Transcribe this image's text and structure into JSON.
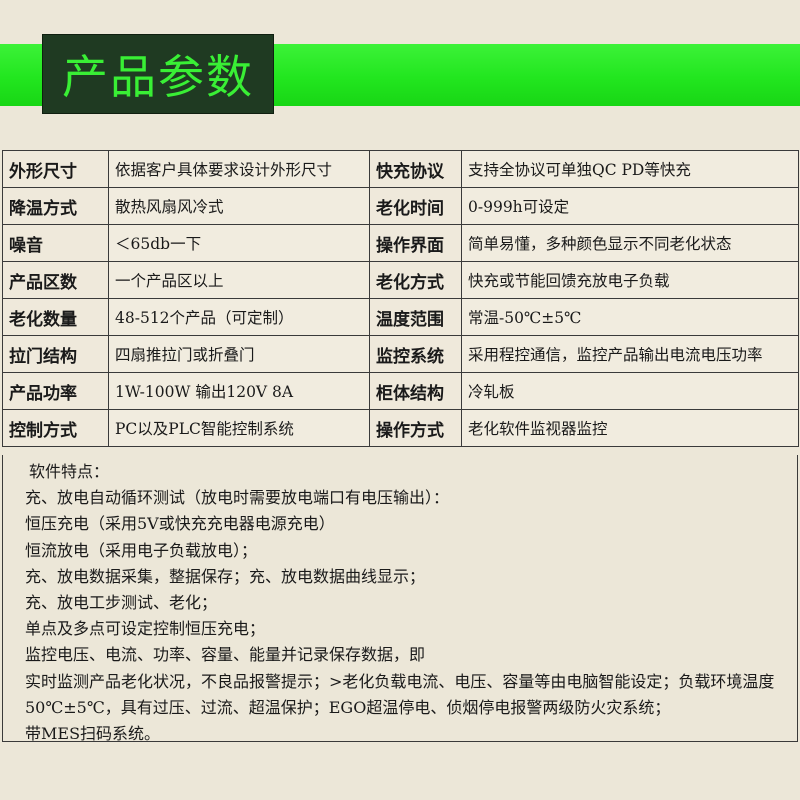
{
  "header": {
    "title": "产品参数"
  },
  "specs": [
    {
      "k1": "外形尺寸",
      "v1": "依据客户具体要求设计外形尺寸",
      "k2": "快充协议",
      "v2": "支持全协议可单独QC PD等快充"
    },
    {
      "k1": "降温方式",
      "v1": "散热风扇风冷式",
      "k2": "老化时间",
      "v2": "0-999h可设定"
    },
    {
      "k1": "噪音",
      "v1": "＜65db一下",
      "k2": "操作界面",
      "v2": "简单易懂，多种颜色显示不同老化状态"
    },
    {
      "k1": "产品区数",
      "v1": "一个产品区以上",
      "k2": "老化方式",
      "v2": "快充或节能回馈充放电子负载"
    },
    {
      "k1": "老化数量",
      "v1": "48-512个产品（可定制）",
      "k2": "温度范围",
      "v2": "常温-50℃±5℃"
    },
    {
      "k1": "拉门结构",
      "v1": "四扇推拉门或折叠门",
      "k2": "监控系统",
      "v2": "采用程控通信，监控产品输出电流电压功率"
    },
    {
      "k1": "产品功率",
      "v1": "1W-100W 输出120V 8A",
      "k2": "柜体结构",
      "v2": "冷轧板"
    },
    {
      "k1": "控制方式",
      "v1": "PC以及PLC智能控制系统",
      "k2": "操作方式",
      "v2": "老化软件监视器监控"
    }
  ],
  "features": {
    "heading": "软件特点：",
    "lines": [
      "充、放电自动循环测试（放电时需要放电端口有电压输出）：",
      "恒压充电（采用5V或快充充电器电源充电）",
      "恒流放电（采用电子负载放电）；",
      "充、放电数据采集，整据保存；充、放电数据曲线显示；",
      "充、放电工步测试、老化；",
      "单点及多点可设定控制恒压充电；",
      "监控电压、电流、功率、容量、能量并记录保存数据，即",
      "实时监测产品老化状况，不良品报警提示；>老化负载电流、电压、容量等由电脑智能设定；负载环境温度",
      "50℃±5℃，具有过压、过流、超温保护；EGO超温停电、侦烟停电报警两级防火灾系统；",
      "带MES扫码系统。"
    ]
  }
}
